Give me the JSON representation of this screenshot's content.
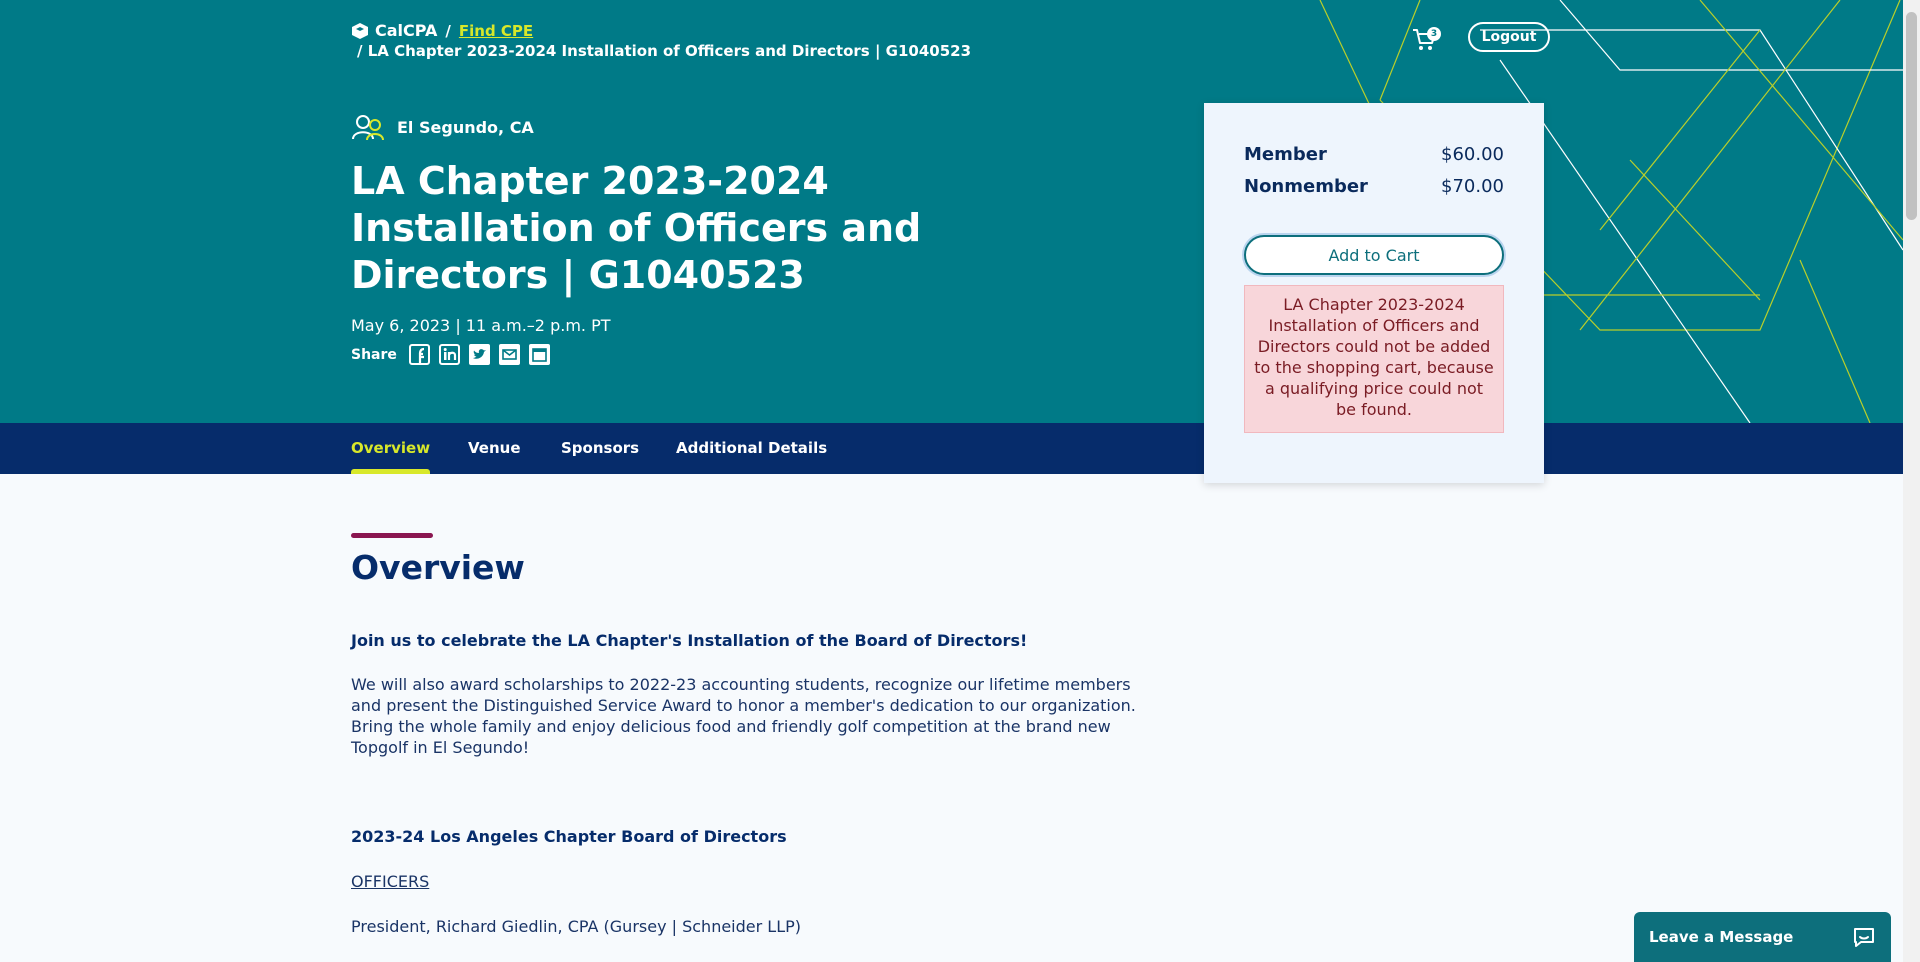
{
  "breadcrumb": {
    "logo_text": "CalCPA",
    "separator": "/",
    "link": "Find CPE",
    "current": "LA Chapter 2023-2024 Installation of Officers and Directors | G1040523"
  },
  "header": {
    "cart_count": "3",
    "logout_label": "Logout"
  },
  "event": {
    "location": "El Segundo, CA",
    "title": "LA Chapter 2023-2024 Installation of Officers and Directors | G1040523",
    "datetime": "May 6, 2023 | 11 a.m.–2 p.m. PT",
    "share_label": "Share",
    "share_icons": [
      "facebook-icon",
      "linkedin-icon",
      "twitter-icon",
      "email-icon",
      "calendar-icon"
    ]
  },
  "tabs": [
    {
      "label": "Overview",
      "active": true
    },
    {
      "label": "Venue",
      "active": false
    },
    {
      "label": "Sponsors",
      "active": false
    },
    {
      "label": "Additional Details",
      "active": false
    }
  ],
  "pricing": {
    "rows": [
      {
        "label": "Member",
        "price": "$60.00"
      },
      {
        "label": "Nonmember",
        "price": "$70.00"
      }
    ],
    "add_to_cart_label": "Add to Cart",
    "error_message": "LA Chapter 2023-2024 Installation of Officers and Directors could not be added to the shopping cart, because a qualifying price could not be found."
  },
  "overview": {
    "heading": "Overview",
    "intro": "Join us to celebrate the LA Chapter's Installation of the Board of Directors!",
    "body": "We will also award scholarships to 2022-23 accounting students, recognize our lifetime members and present the Distinguished Service Award to honor a member's dedication to our organization. Bring the whole family and enjoy delicious food and friendly golf competition at the brand new Topgolf in El Segundo!",
    "board_heading": "2023-24 Los Angeles Chapter Board of Directors",
    "officers_label": "OFFICERS",
    "president_role": "President",
    "president_name": ", Richard Giedlin, CPA (Gursey | Schneider LLP)"
  },
  "chat": {
    "label": "Leave a Message"
  },
  "colors": {
    "hero": "#007a87",
    "nav": "#062c6b",
    "accent": "#d8e82a",
    "heading_bar": "#8a1650"
  }
}
